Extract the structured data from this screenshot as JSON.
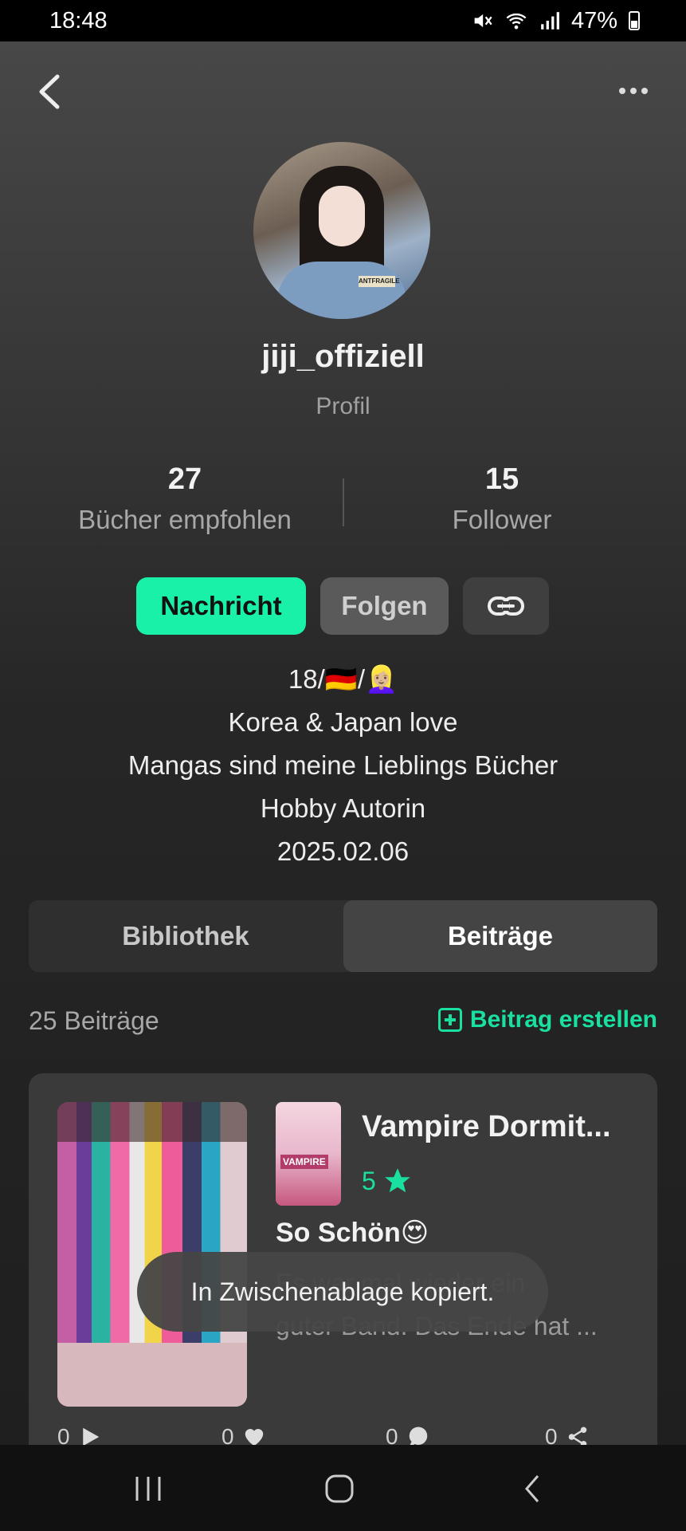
{
  "status_bar": {
    "time": "18:48",
    "battery": "47%"
  },
  "profile": {
    "username": "jiji_offiziell",
    "subtitle": "Profil",
    "stats": {
      "books_count": "27",
      "books_label": "Bücher empfohlen",
      "followers_count": "15",
      "followers_label": "Follower"
    }
  },
  "actions": {
    "message_label": "Nachricht",
    "follow_label": "Folgen"
  },
  "bio": [
    "18/🇩🇪/👱🏼‍♀️",
    "Korea & Japan love",
    "Mangas sind meine Lieblings Bücher",
    "Hobby Autorin",
    "2025.02.06"
  ],
  "tabs": {
    "library": "Bibliothek",
    "posts": "Beiträge",
    "active": "posts"
  },
  "posts_header": {
    "count_label": "25 Beiträge",
    "create_label": "Beitrag erstellen"
  },
  "post": {
    "book_title": "Vampire Dormit...",
    "cover_text": "VAMPIRE",
    "rating": "5",
    "heading": "So Schön😍",
    "text_line1": "Es war mal wieder ein",
    "text_line2": "guter Band. Das Ende hat ...",
    "footer": {
      "plays": "0",
      "likes": "0",
      "comments": "0",
      "shares": "0"
    }
  },
  "toast": "In Zwischenablage kopiert.",
  "colors": {
    "accent": "#19f0a8",
    "background": "#262626"
  },
  "icons": [
    "back-icon",
    "more-icon",
    "link-icon",
    "plus-square-icon",
    "star-icon",
    "play-icon",
    "heart-icon",
    "comment-icon",
    "share-icon",
    "recent-apps-icon",
    "home-icon",
    "nav-back-icon"
  ]
}
